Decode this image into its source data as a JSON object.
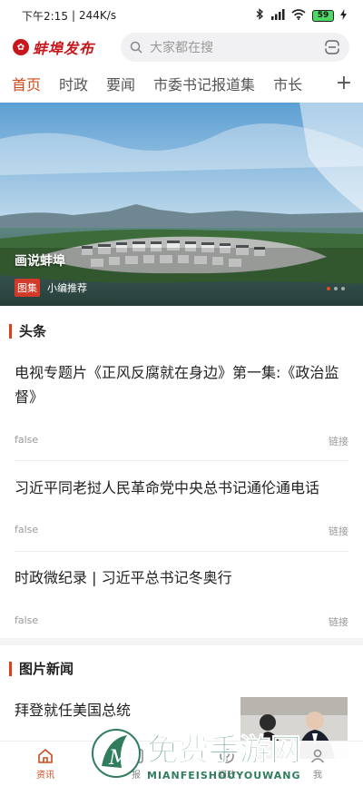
{
  "status_bar": {
    "time": "下午2:15",
    "network_speed": "244K/s",
    "battery": "59"
  },
  "header": {
    "logo_text": "蚌埠发布",
    "search_placeholder": "大家都在搜"
  },
  "tabs": [
    {
      "label": "首页",
      "active": true
    },
    {
      "label": "时政",
      "active": false
    },
    {
      "label": "要闻",
      "active": false
    },
    {
      "label": "市委书记报道集",
      "active": false
    },
    {
      "label": "市长",
      "active": false
    }
  ],
  "banner": {
    "title": "画说蚌埠",
    "tag": "图集",
    "subtitle": "小编推荐"
  },
  "headlines": {
    "section_title": "头条",
    "items": [
      {
        "title": "电视专题片《正风反腐就在身边》第一集:《政治监督》",
        "meta_left": "false",
        "meta_right": "链接"
      },
      {
        "title": "习近平同老挝人民革命党中央总书记通伦通电话",
        "meta_left": "false",
        "meta_right": "链接"
      },
      {
        "title": "时政微纪录 | 习近平总书记冬奥行",
        "meta_left": "false",
        "meta_right": "链接"
      }
    ]
  },
  "photo_news": {
    "section_title": "图片新闻",
    "items": [
      {
        "title": "拜登就任美国总统"
      }
    ]
  },
  "bottom_nav": [
    {
      "label": "资讯",
      "active": true
    },
    {
      "label": "报",
      "active": false
    },
    {
      "label": "问政",
      "active": false
    },
    {
      "label": "我",
      "active": false
    }
  ],
  "watermark": {
    "main": "免费手游网",
    "sub": "MIANFEISHOUYOUWANG"
  }
}
